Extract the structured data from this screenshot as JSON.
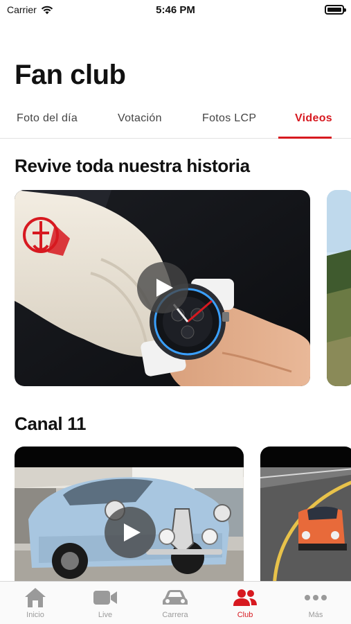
{
  "status": {
    "carrier": "Carrier",
    "time": "5:46 PM"
  },
  "page": {
    "title": "Fan club"
  },
  "tabs": [
    {
      "label": "Foto del día"
    },
    {
      "label": "Votación"
    },
    {
      "label": "Fotos LCP"
    },
    {
      "label": "Videos",
      "active": true
    }
  ],
  "sections": [
    {
      "title": "Revive toda nuestra historia"
    },
    {
      "title": "Canal 11"
    }
  ],
  "tabbar": [
    {
      "label": "Inicio",
      "icon": "home-icon"
    },
    {
      "label": "Live",
      "icon": "video-camera-icon"
    },
    {
      "label": "Carrera",
      "icon": "car-icon"
    },
    {
      "label": "Club",
      "icon": "group-icon",
      "active": true
    },
    {
      "label": "Más",
      "icon": "more-icon"
    }
  ],
  "colors": {
    "accent": "#d71920",
    "inactive": "#9a9a9a"
  }
}
